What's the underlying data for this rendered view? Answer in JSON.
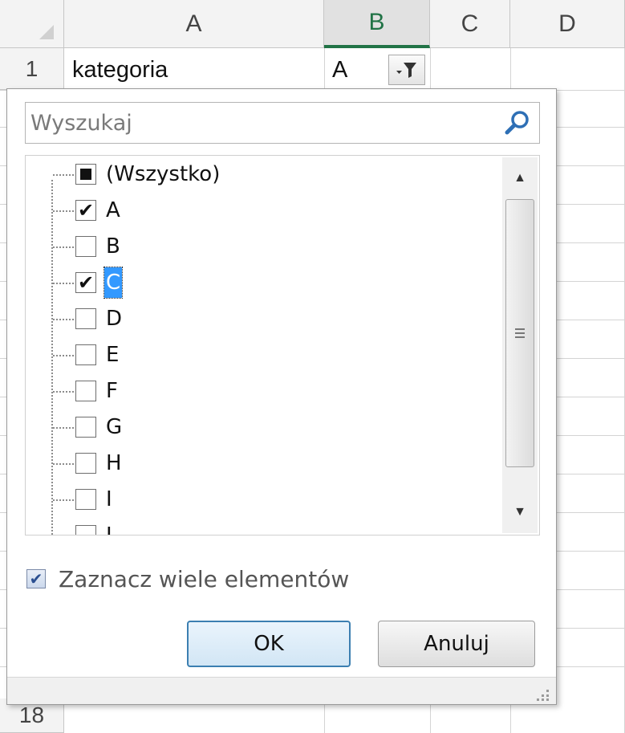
{
  "spreadsheet": {
    "columns": [
      {
        "label": "A",
        "selected": false
      },
      {
        "label": "B",
        "selected": true
      },
      {
        "label": "C",
        "selected": false
      },
      {
        "label": "D",
        "selected": false
      }
    ],
    "rows": {
      "first": "1",
      "last": "18"
    },
    "cells": {
      "a1": "kategoria",
      "b1": "A"
    },
    "filter_icon": "filter-dropdown-icon"
  },
  "filter_panel": {
    "search": {
      "placeholder": "Wyszukaj",
      "value": "",
      "icon": "search-icon"
    },
    "items": [
      {
        "label": "(Wszystko)",
        "state": "indeterminate"
      },
      {
        "label": "A",
        "state": "checked"
      },
      {
        "label": "B",
        "state": "unchecked"
      },
      {
        "label": "C",
        "state": "checked",
        "focused": true
      },
      {
        "label": "D",
        "state": "unchecked"
      },
      {
        "label": "E",
        "state": "unchecked"
      },
      {
        "label": "F",
        "state": "unchecked"
      },
      {
        "label": "G",
        "state": "unchecked"
      },
      {
        "label": "H",
        "state": "unchecked"
      },
      {
        "label": "I",
        "state": "unchecked"
      },
      {
        "label": "J",
        "state": "unchecked"
      }
    ],
    "multi_select": {
      "label": "Zaznacz wiele elementów",
      "checked": true
    },
    "buttons": {
      "ok": "OK",
      "cancel": "Anuluj"
    },
    "colors": {
      "focus": "#3399ff",
      "ok_border": "#3c7fb1",
      "selected_col": "#217346"
    }
  }
}
